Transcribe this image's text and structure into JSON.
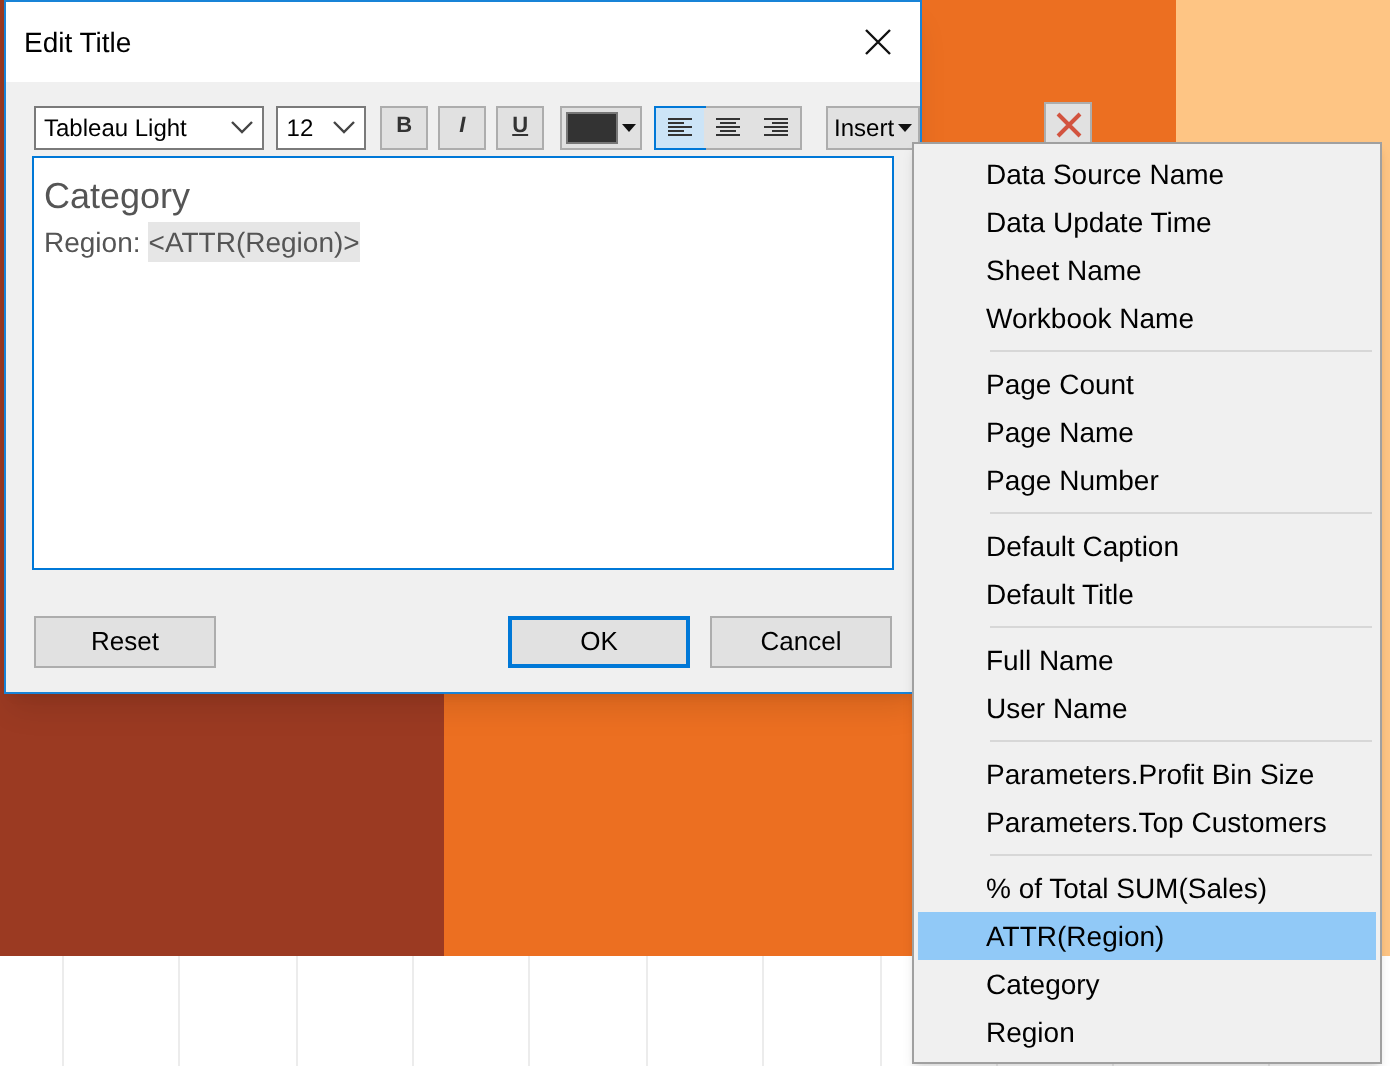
{
  "dialog": {
    "title": "Edit Title",
    "font": "Tableau Light",
    "size": "12",
    "format_buttons": [
      {
        "kind": "bold",
        "label": "B",
        "selected": false
      },
      {
        "kind": "italic",
        "label": "I",
        "selected": false
      },
      {
        "kind": "underline",
        "label": "U",
        "selected": false
      }
    ],
    "alignments": [
      {
        "kind": "left",
        "selected": true
      },
      {
        "kind": "center",
        "selected": false
      },
      {
        "kind": "right",
        "selected": false
      }
    ],
    "insert_button": "Insert",
    "editor": {
      "heading": "Category",
      "label": "Region:",
      "token": "<ATTR(Region)>"
    },
    "buttons": [
      {
        "label": "Reset",
        "focused": false
      },
      {
        "label": "OK",
        "focused": true
      },
      {
        "label": "Cancel",
        "focused": false
      }
    ]
  },
  "insert_menu": {
    "groups": [
      [
        {
          "label": "Data Source Name",
          "selected": false
        },
        {
          "label": "Data Update Time",
          "selected": false
        },
        {
          "label": "Sheet Name",
          "selected": false
        },
        {
          "label": "Workbook Name",
          "selected": false
        }
      ],
      [
        {
          "label": "Page Count",
          "selected": false
        },
        {
          "label": "Page Name",
          "selected": false
        },
        {
          "label": "Page Number",
          "selected": false
        }
      ],
      [
        {
          "label": "Default Caption",
          "selected": false
        },
        {
          "label": "Default Title",
          "selected": false
        }
      ],
      [
        {
          "label": "Full Name",
          "selected": false
        },
        {
          "label": "User Name",
          "selected": false
        }
      ],
      [
        {
          "label": "Parameters.Profit Bin Size",
          "selected": false
        },
        {
          "label": "Parameters.Top Customers",
          "selected": false
        }
      ],
      [
        {
          "label": "% of Total SUM(Sales)",
          "selected": false
        },
        {
          "label": "ATTR(Region)",
          "selected": true
        },
        {
          "label": "Category",
          "selected": false
        },
        {
          "label": "Region",
          "selected": false
        }
      ]
    ]
  }
}
